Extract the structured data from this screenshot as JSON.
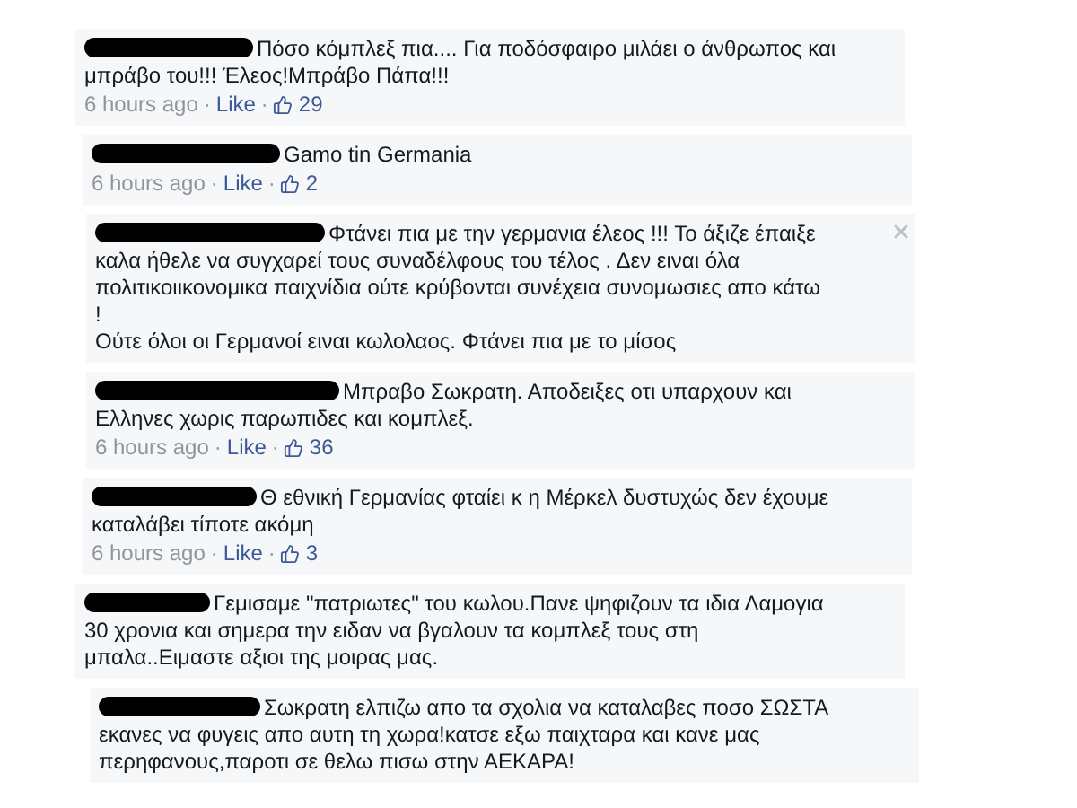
{
  "comments": [
    {
      "text": "Πόσο κόμπλεξ πια.... Για ποδόσφαιρο μιλάει ο άνθρωπος και μπράβο του!!! Έλεος!Μπράβο Πάπα!!!",
      "closable": false,
      "meta": {
        "time": "6 hours ago",
        "separator": "·",
        "like": "Like",
        "likes": "29"
      }
    },
    {
      "text": "Gamo tin Germania",
      "closable": false,
      "meta": {
        "time": "6 hours ago",
        "separator": "·",
        "like": "Like",
        "likes": "2"
      }
    },
    {
      "text": "Φτάνει πια με την γερμανια έλεος !!! Το άξιζε έπαιξε καλα ήθελε να συγχαρεί τους συναδέλφους του τέλος . Δεν ειναι όλα πολιτικοιικονομικα παιχνίδια ούτε κρύβονται συνέχεια συνομωσιες απο κάτω\n!\nΟύτε όλοι οι Γερμανοί ειναι κωλολαος. Φτάνει πια με το μίσος",
      "closable": true
    },
    {
      "text": "Μπραβο Σωκρατη. Αποδειξες οτι υπαρχουν και Ελληνες χωρις παρωπιδες και κομπλεξ.",
      "closable": false,
      "meta": {
        "time": "6 hours ago",
        "separator": "·",
        "like": "Like",
        "likes": "36"
      }
    },
    {
      "text": "Θ εθνική Γερμανίας φταίει κ η Μέρκελ δυστυχώς δεν έχουμε καταλάβει τίποτε ακόμη",
      "closable": false,
      "meta": {
        "time": "6 hours ago",
        "separator": "·",
        "like": "Like",
        "likes": "3"
      }
    },
    {
      "text": "Γεμισαμε \"πατριωτες\" του κωλου.Πανε ψηφιζουν τα ιδια Λαμογια 30 χρονια και σημερα την ειδαν να βγαλουν τα κομπλεξ τους στη μπαλα..Ειμαστε αξιοι της μοιρας μας.",
      "closable": false
    },
    {
      "text": "Σωκρατη ελπιζω απο τα σχολια να καταλαβες ποσο ΣΩΣΤΑ εκανες να φυγεις απο αυτη τη χωρα!κατσε εξω παιχταρα και κανε μας περηφανους,παροτι σε θελω πισω στην ΑΕΚΑΡΑ!",
      "closable": false
    }
  ]
}
